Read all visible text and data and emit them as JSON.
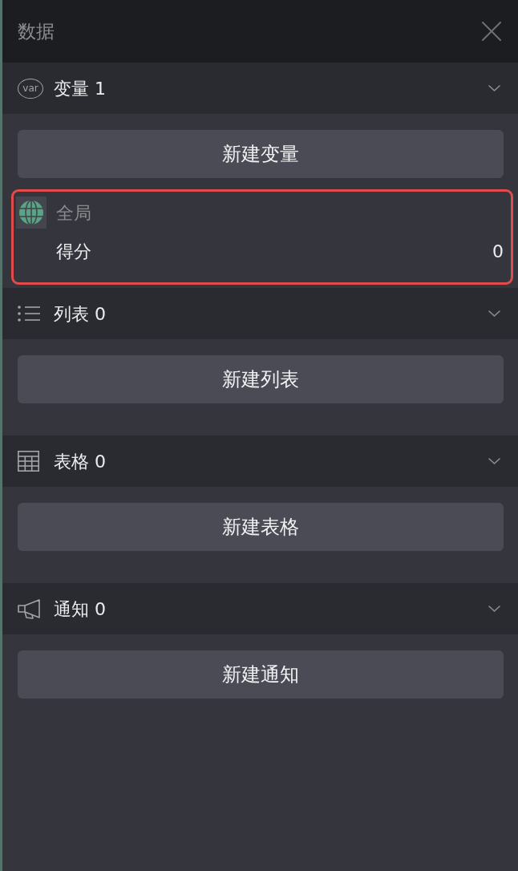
{
  "panel": {
    "title": "数据"
  },
  "sections": [
    {
      "kind": "variables",
      "badge": "var",
      "label": "变量 1",
      "expanded": true,
      "button": "新建变量",
      "items": [
        {
          "scope": "全局",
          "name": "得分",
          "value": "0",
          "highlighted": true
        }
      ]
    },
    {
      "kind": "lists",
      "label": "列表 0",
      "expanded": true,
      "button": "新建列表"
    },
    {
      "kind": "tables",
      "label": "表格 0",
      "expanded": true,
      "button": "新建表格"
    },
    {
      "kind": "notices",
      "label": "通知 0",
      "expanded": true,
      "button": "新建通知"
    }
  ]
}
